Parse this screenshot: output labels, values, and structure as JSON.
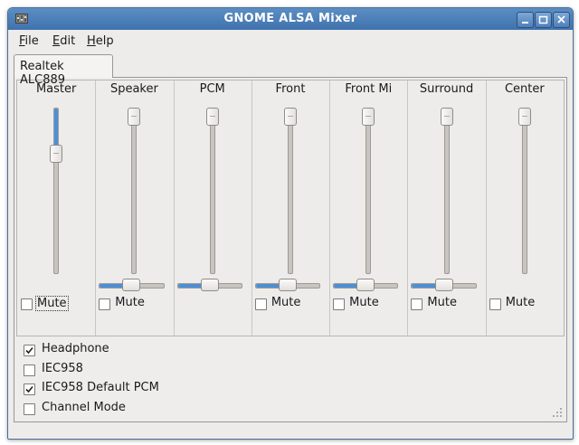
{
  "window": {
    "title": "GNOME ALSA Mixer"
  },
  "menu": [
    {
      "key": "F",
      "rest": "ile"
    },
    {
      "key": "E",
      "rest": "dit"
    },
    {
      "key": "H",
      "rest": "elp"
    }
  ],
  "tab": {
    "label": "Realtek ALC889"
  },
  "channels": [
    {
      "name": "Master",
      "volume": 0.75,
      "balance": null,
      "mute_label": "Mute",
      "muted": false
    },
    {
      "name": "Speaker",
      "volume": 1.0,
      "balance": 0.5,
      "mute_label": "Mute",
      "muted": false
    },
    {
      "name": "PCM",
      "volume": 1.0,
      "balance": 0.5,
      "mute_label": "",
      "muted": false
    },
    {
      "name": "Front",
      "volume": 1.0,
      "balance": 0.5,
      "mute_label": "Mute",
      "muted": false
    },
    {
      "name": "Front Mi",
      "volume": 1.0,
      "balance": 0.5,
      "mute_label": "Mute",
      "muted": false
    },
    {
      "name": "Surround",
      "volume": 1.0,
      "balance": 0.5,
      "mute_label": "Mute",
      "muted": false
    },
    {
      "name": "Center",
      "volume": 1.0,
      "balance": null,
      "mute_label": "Mute",
      "muted": false
    }
  ],
  "options": [
    {
      "label": "Headphone",
      "checked": true
    },
    {
      "label": "IEC958",
      "checked": false
    },
    {
      "label": "IEC958 Default PCM",
      "checked": true
    },
    {
      "label": "Channel Mode",
      "checked": false
    }
  ],
  "icons": {
    "app": "mixer-icon",
    "minimize": "minimize-icon",
    "maximize": "maximize-icon",
    "close": "close-icon",
    "resize": "resize-grip-icon"
  },
  "colors": {
    "titlebar": "#4a7cb8",
    "slider_fill": "#4d8fd6",
    "window_bg": "#edeceb"
  }
}
